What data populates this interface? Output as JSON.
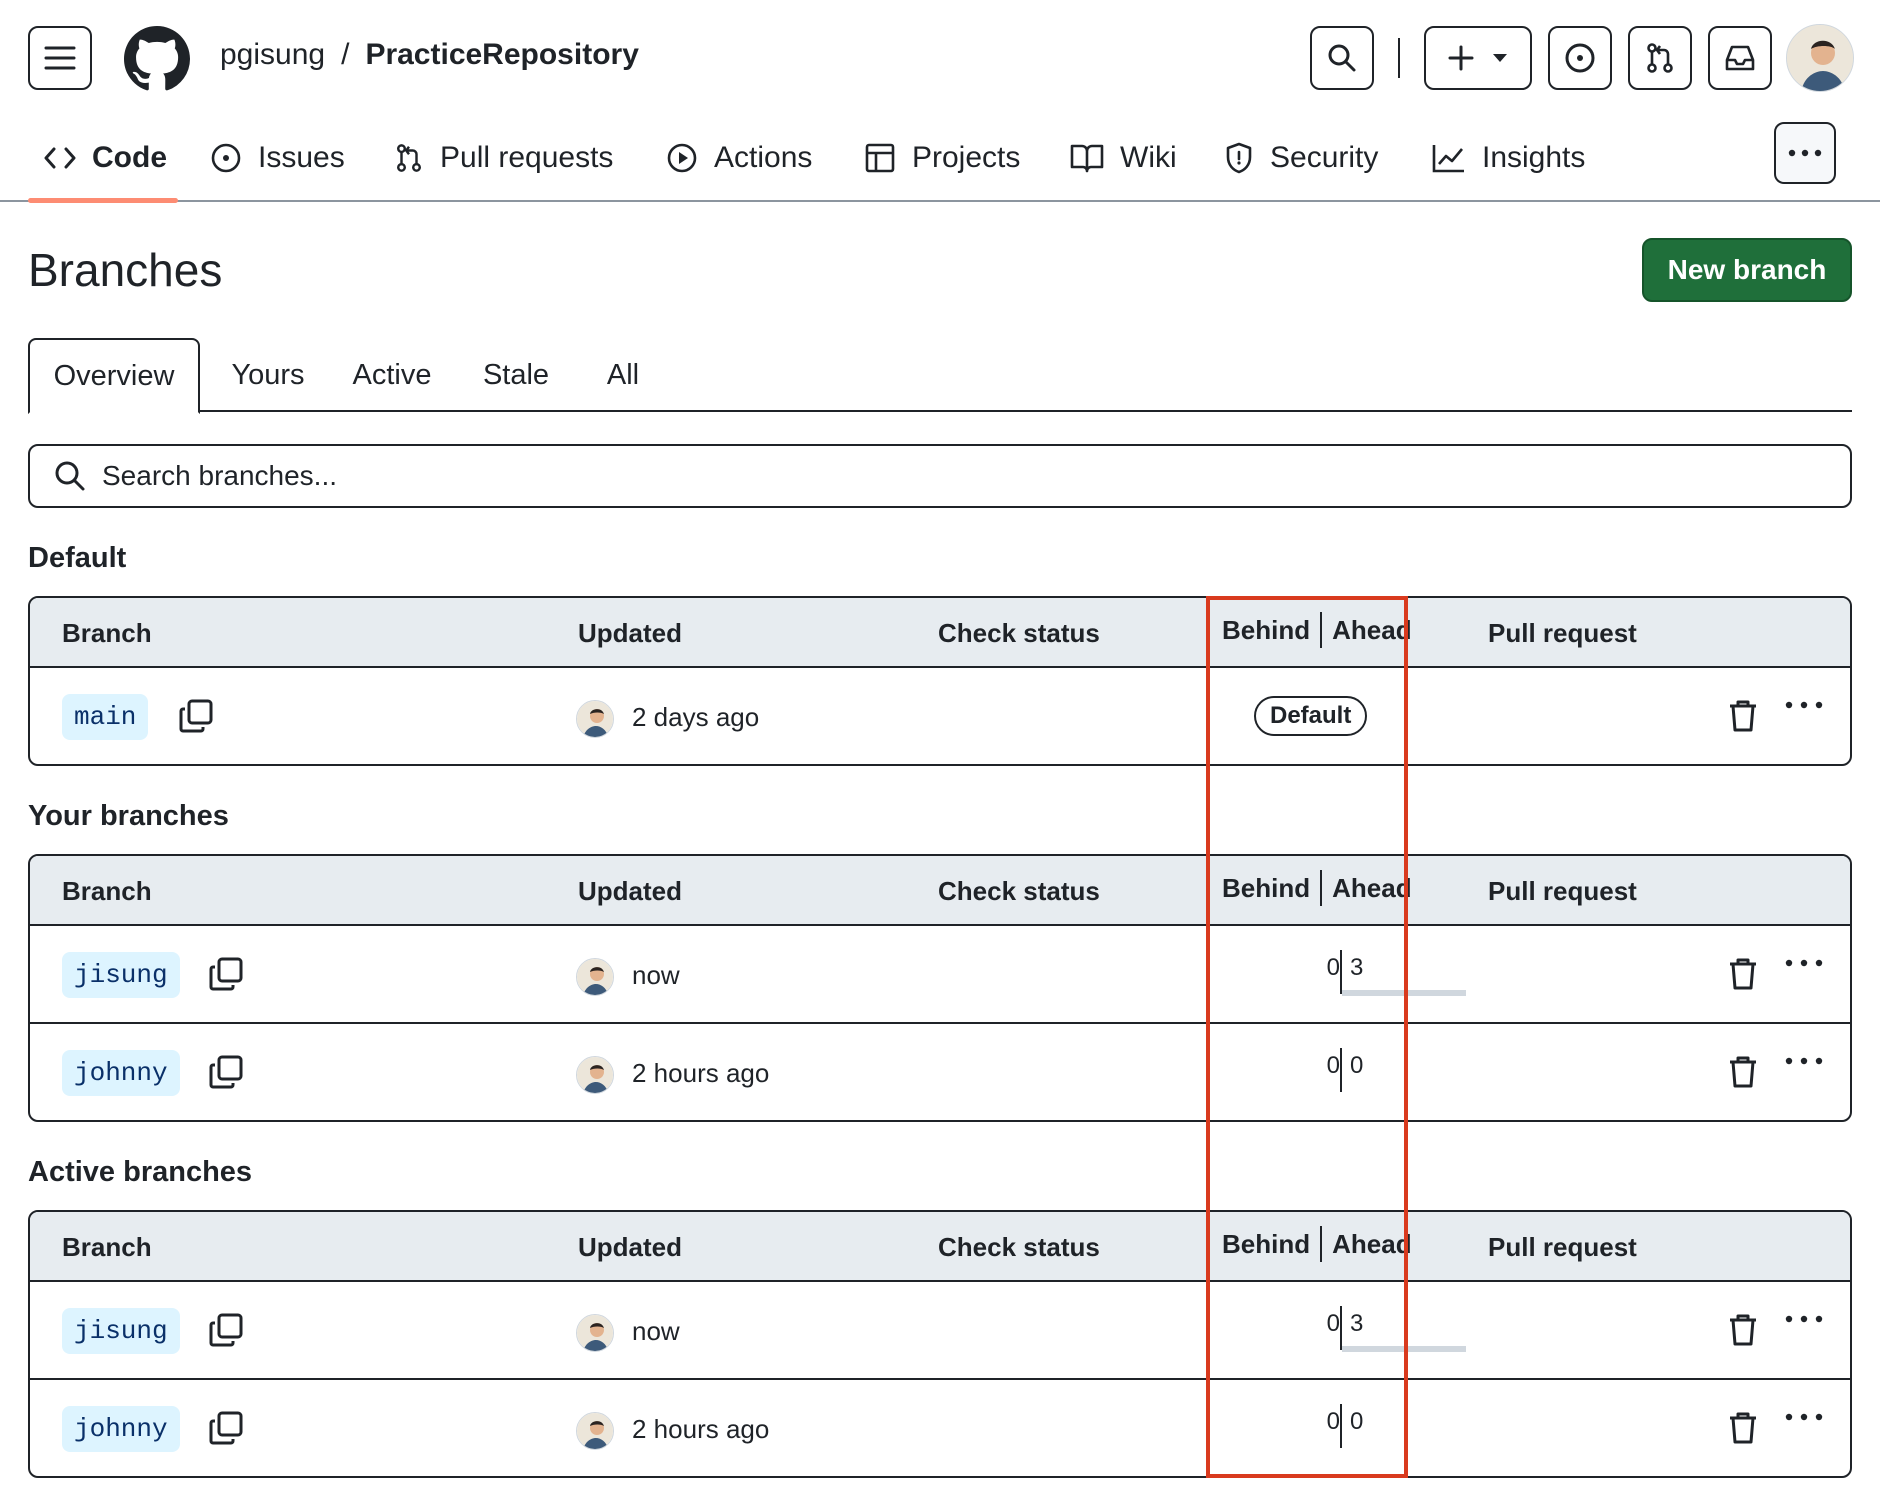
{
  "header": {
    "owner": "pgisung",
    "separator": "/",
    "repo": "PracticeRepository"
  },
  "nav": {
    "tabs": [
      {
        "label": "Code",
        "icon": "code-icon"
      },
      {
        "label": "Issues",
        "icon": "issue-icon"
      },
      {
        "label": "Pull requests",
        "icon": "pull-request-icon"
      },
      {
        "label": "Actions",
        "icon": "play-icon"
      },
      {
        "label": "Projects",
        "icon": "table-icon"
      },
      {
        "label": "Wiki",
        "icon": "book-icon"
      },
      {
        "label": "Security",
        "icon": "shield-icon"
      },
      {
        "label": "Insights",
        "icon": "graph-icon"
      }
    ],
    "active": "Code"
  },
  "page": {
    "title": "Branches",
    "new_branch_label": "New branch"
  },
  "filters": {
    "tabs": [
      "Overview",
      "Yours",
      "Active",
      "Stale",
      "All"
    ],
    "selected": "Overview"
  },
  "search": {
    "placeholder": "Search branches..."
  },
  "columns": {
    "branch": "Branch",
    "updated": "Updated",
    "check_status": "Check status",
    "behind": "Behind",
    "ahead": "Ahead",
    "pull_request": "Pull request"
  },
  "sections": {
    "default": {
      "title": "Default",
      "rows": [
        {
          "name": "main",
          "updated": "2 days ago",
          "badge": "Default"
        }
      ]
    },
    "yours": {
      "title": "Your branches",
      "rows": [
        {
          "name": "jisung",
          "updated": "now",
          "behind": "0",
          "ahead": "3",
          "ahead_fraction": 1.0
        },
        {
          "name": "johnny",
          "updated": "2 hours ago",
          "behind": "0",
          "ahead": "0",
          "ahead_fraction": 0
        }
      ]
    },
    "active": {
      "title": "Active branches",
      "rows": [
        {
          "name": "jisung",
          "updated": "now",
          "behind": "0",
          "ahead": "3",
          "ahead_fraction": 1.0
        },
        {
          "name": "johnny",
          "updated": "2 hours ago",
          "behind": "0",
          "ahead": "0",
          "ahead_fraction": 0
        }
      ]
    }
  },
  "colors": {
    "primary_button": "#1f6f3a",
    "branch_pill_bg": "#ddf4ff",
    "branch_pill_text": "#0a3069",
    "highlight_box": "#d93a1e",
    "nav_underline": "#fd8c73"
  }
}
